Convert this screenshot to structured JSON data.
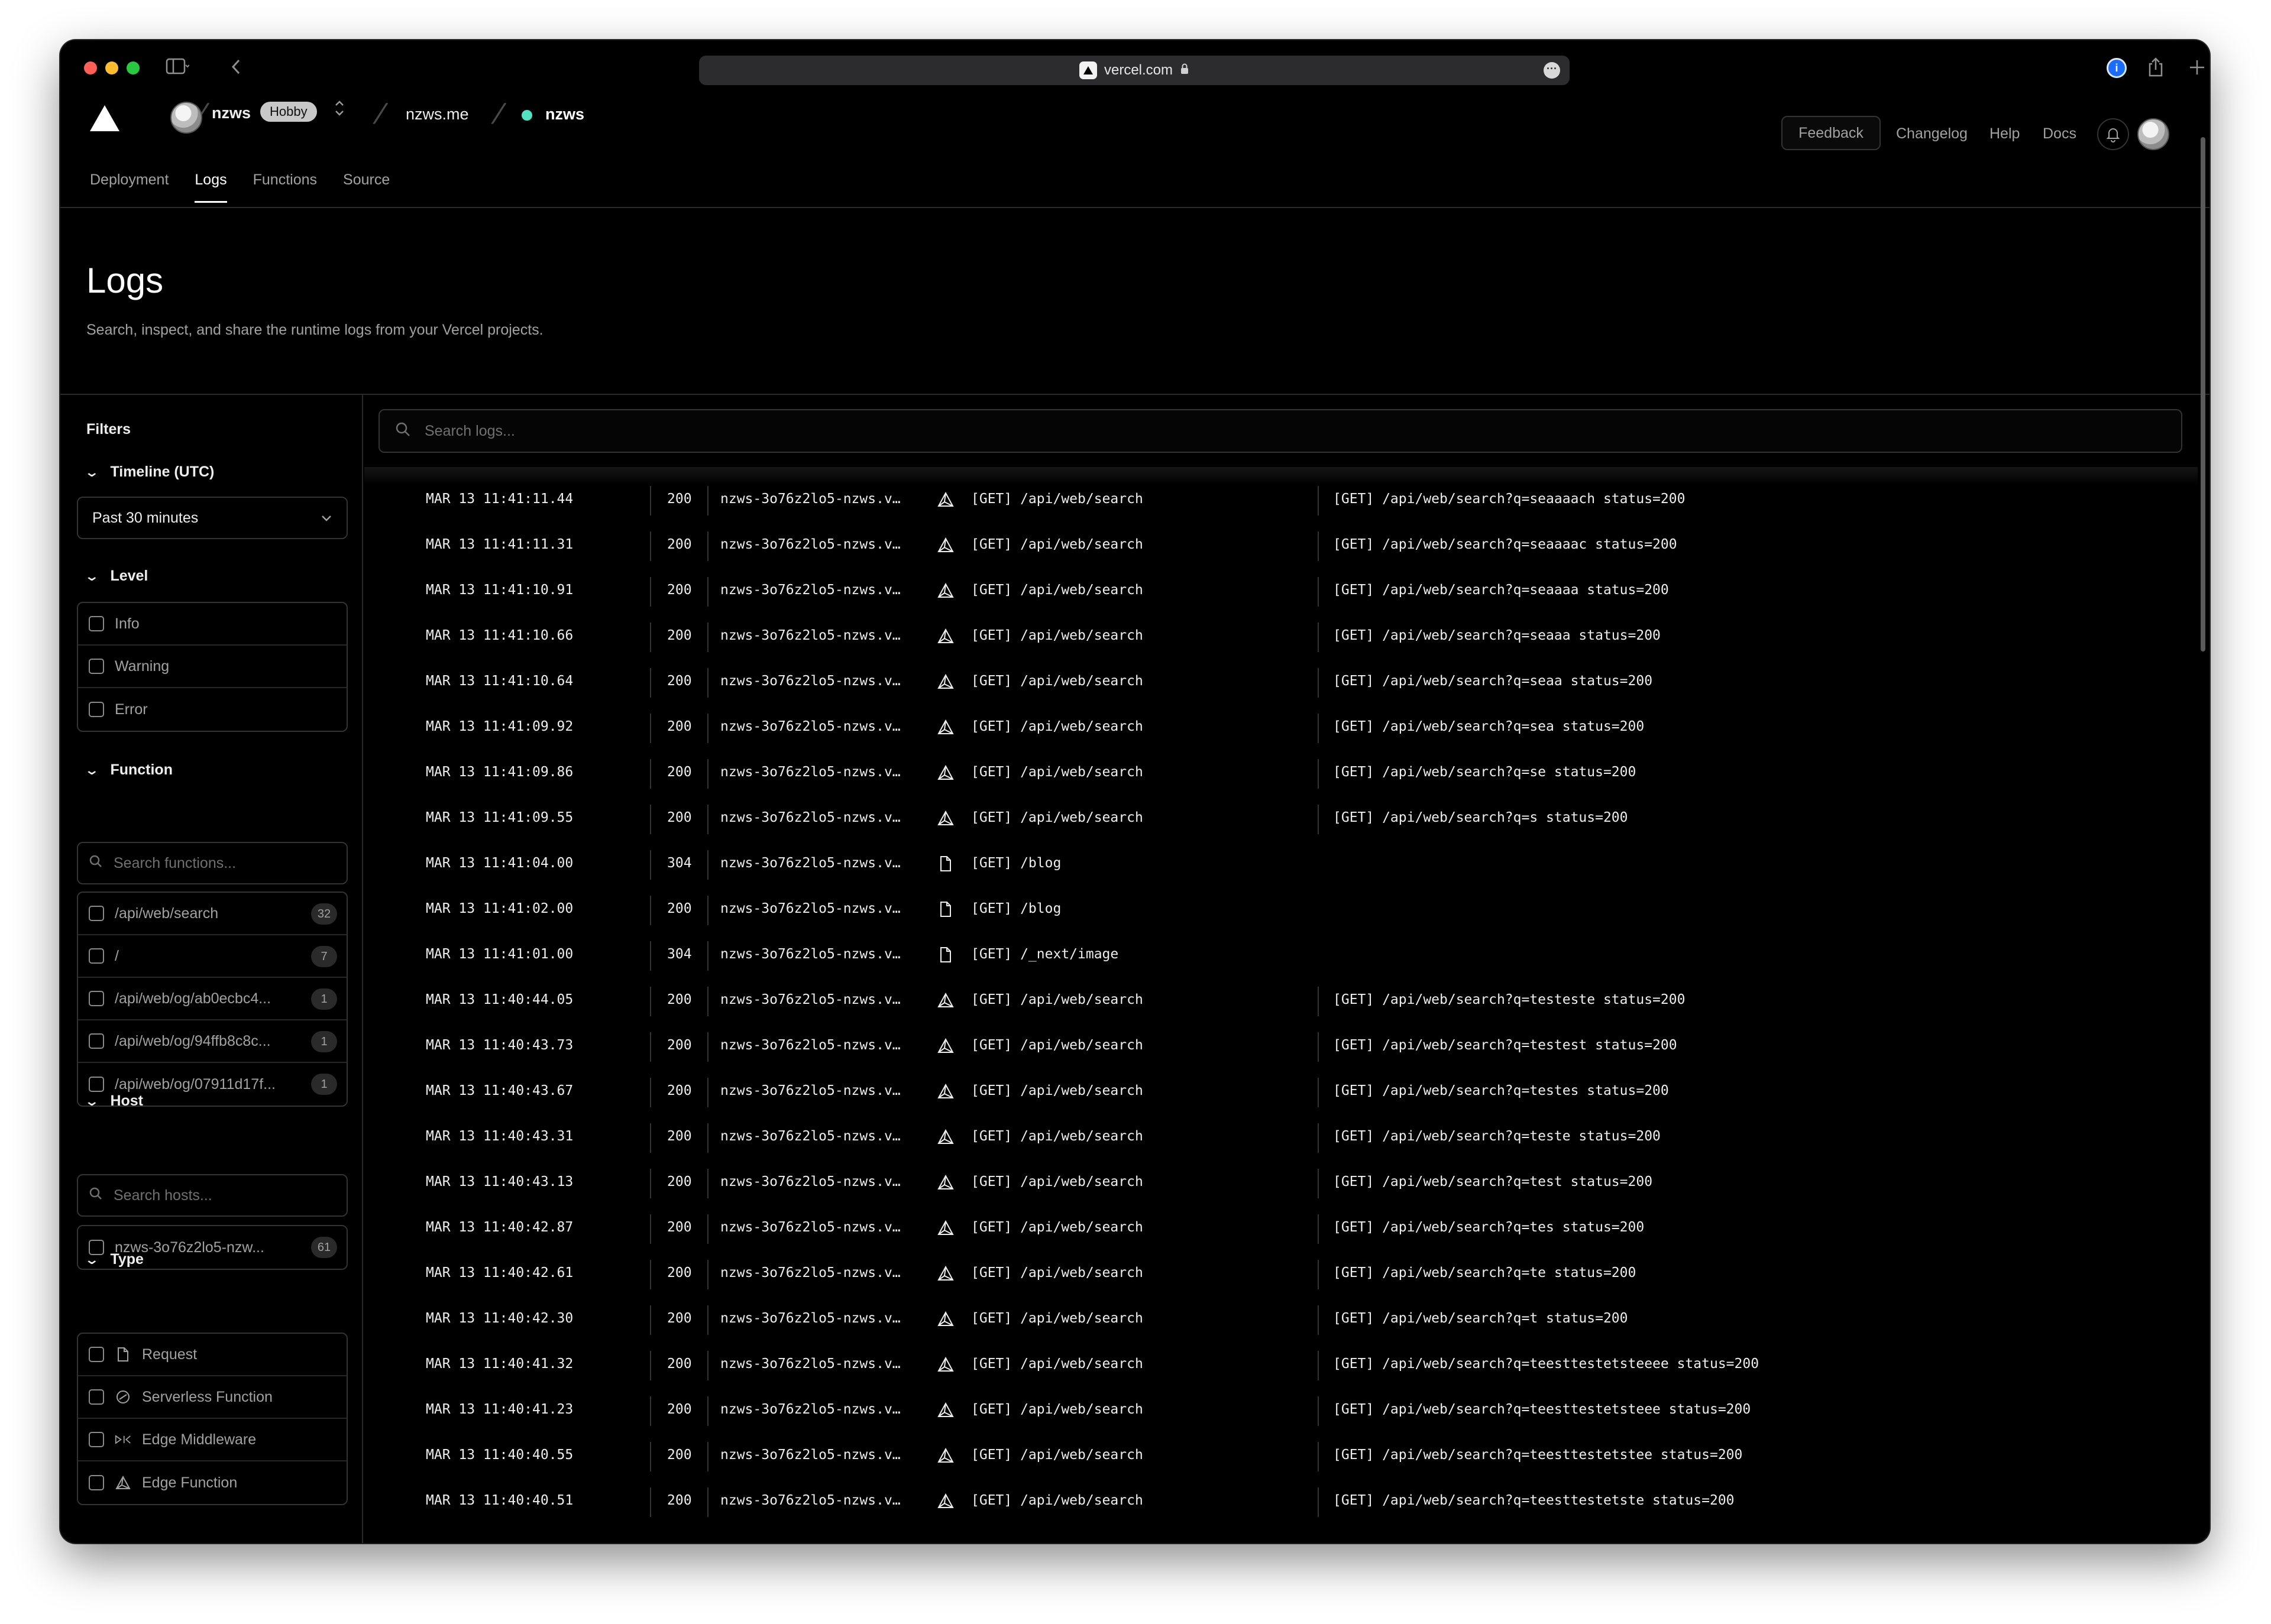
{
  "browser": {
    "url": "vercel.com",
    "colors": {
      "close": "#ff5f57",
      "minimize": "#febc2e",
      "zoom": "#28c840"
    }
  },
  "header": {
    "team": "nzws",
    "plan_badge": "Hobby",
    "project": "nzws.me",
    "deployment": "nzws",
    "deployment_status_color": "#50e3c2",
    "feedback_label": "Feedback",
    "links": [
      "Changelog",
      "Help",
      "Docs"
    ]
  },
  "tabs": [
    "Deployment",
    "Logs",
    "Functions",
    "Source"
  ],
  "active_tab": "Logs",
  "page": {
    "title": "Logs",
    "subtitle": "Search, inspect, and share the runtime logs from your Vercel projects."
  },
  "filters": {
    "title": "Filters",
    "timeline": {
      "label": "Timeline (UTC)",
      "selected": "Past 30 minutes"
    },
    "level": {
      "label": "Level",
      "options": [
        "Info",
        "Warning",
        "Error"
      ]
    },
    "function": {
      "label": "Function",
      "search_placeholder": "Search functions...",
      "items": [
        {
          "name": "/api/web/search",
          "count": "32"
        },
        {
          "name": "/",
          "count": "7"
        },
        {
          "name": "/api/web/og/ab0ecbc4...",
          "count": "1"
        },
        {
          "name": "/api/web/og/94ffb8c8c...",
          "count": "1"
        },
        {
          "name": "/api/web/og/07911d17f...",
          "count": "1"
        }
      ]
    },
    "host": {
      "label": "Host",
      "search_placeholder": "Search hosts...",
      "items": [
        {
          "name": "nzws-3o76z2lo5-nzw...",
          "count": "61"
        }
      ]
    },
    "type": {
      "label": "Type",
      "items": [
        {
          "name": "Request",
          "icon": "file-icon"
        },
        {
          "name": "Serverless Function",
          "icon": "lambda-icon"
        },
        {
          "name": "Edge Middleware",
          "icon": "middleware-icon"
        },
        {
          "name": "Edge Function",
          "icon": "edge-function-icon"
        }
      ]
    }
  },
  "logs": {
    "search_placeholder": "Search logs...",
    "rows": [
      {
        "time": "MAR 13 11:41:11.44",
        "status": "200",
        "host": "nzws-3o76z2lo5-nzws.v…",
        "icon": "edge-function-icon",
        "request": "[GET] /api/web/search",
        "message": "[GET] /api/web/search?q=seaaaach status=200"
      },
      {
        "time": "MAR 13 11:41:11.31",
        "status": "200",
        "host": "nzws-3o76z2lo5-nzws.v…",
        "icon": "edge-function-icon",
        "request": "[GET] /api/web/search",
        "message": "[GET] /api/web/search?q=seaaaac status=200"
      },
      {
        "time": "MAR 13 11:41:10.91",
        "status": "200",
        "host": "nzws-3o76z2lo5-nzws.v…",
        "icon": "edge-function-icon",
        "request": "[GET] /api/web/search",
        "message": "[GET] /api/web/search?q=seaaaa status=200"
      },
      {
        "time": "MAR 13 11:41:10.66",
        "status": "200",
        "host": "nzws-3o76z2lo5-nzws.v…",
        "icon": "edge-function-icon",
        "request": "[GET] /api/web/search",
        "message": "[GET] /api/web/search?q=seaaa status=200"
      },
      {
        "time": "MAR 13 11:41:10.64",
        "status": "200",
        "host": "nzws-3o76z2lo5-nzws.v…",
        "icon": "edge-function-icon",
        "request": "[GET] /api/web/search",
        "message": "[GET] /api/web/search?q=seaa status=200"
      },
      {
        "time": "MAR 13 11:41:09.92",
        "status": "200",
        "host": "nzws-3o76z2lo5-nzws.v…",
        "icon": "edge-function-icon",
        "request": "[GET] /api/web/search",
        "message": "[GET] /api/web/search?q=sea status=200"
      },
      {
        "time": "MAR 13 11:41:09.86",
        "status": "200",
        "host": "nzws-3o76z2lo5-nzws.v…",
        "icon": "edge-function-icon",
        "request": "[GET] /api/web/search",
        "message": "[GET] /api/web/search?q=se status=200"
      },
      {
        "time": "MAR 13 11:41:09.55",
        "status": "200",
        "host": "nzws-3o76z2lo5-nzws.v…",
        "icon": "edge-function-icon",
        "request": "[GET] /api/web/search",
        "message": "[GET] /api/web/search?q=s status=200"
      },
      {
        "time": "MAR 13 11:41:04.00",
        "status": "304",
        "host": "nzws-3o76z2lo5-nzws.v…",
        "icon": "file-icon",
        "request": "[GET] /blog",
        "message": ""
      },
      {
        "time": "MAR 13 11:41:02.00",
        "status": "200",
        "host": "nzws-3o76z2lo5-nzws.v…",
        "icon": "file-icon",
        "request": "[GET] /blog",
        "message": ""
      },
      {
        "time": "MAR 13 11:41:01.00",
        "status": "304",
        "host": "nzws-3o76z2lo5-nzws.v…",
        "icon": "file-icon",
        "request": "[GET] /_next/image",
        "message": ""
      },
      {
        "time": "MAR 13 11:40:44.05",
        "status": "200",
        "host": "nzws-3o76z2lo5-nzws.v…",
        "icon": "edge-function-icon",
        "request": "[GET] /api/web/search",
        "message": "[GET] /api/web/search?q=testeste status=200"
      },
      {
        "time": "MAR 13 11:40:43.73",
        "status": "200",
        "host": "nzws-3o76z2lo5-nzws.v…",
        "icon": "edge-function-icon",
        "request": "[GET] /api/web/search",
        "message": "[GET] /api/web/search?q=testest status=200"
      },
      {
        "time": "MAR 13 11:40:43.67",
        "status": "200",
        "host": "nzws-3o76z2lo5-nzws.v…",
        "icon": "edge-function-icon",
        "request": "[GET] /api/web/search",
        "message": "[GET] /api/web/search?q=testes status=200"
      },
      {
        "time": "MAR 13 11:40:43.31",
        "status": "200",
        "host": "nzws-3o76z2lo5-nzws.v…",
        "icon": "edge-function-icon",
        "request": "[GET] /api/web/search",
        "message": "[GET] /api/web/search?q=teste status=200"
      },
      {
        "time": "MAR 13 11:40:43.13",
        "status": "200",
        "host": "nzws-3o76z2lo5-nzws.v…",
        "icon": "edge-function-icon",
        "request": "[GET] /api/web/search",
        "message": "[GET] /api/web/search?q=test status=200"
      },
      {
        "time": "MAR 13 11:40:42.87",
        "status": "200",
        "host": "nzws-3o76z2lo5-nzws.v…",
        "icon": "edge-function-icon",
        "request": "[GET] /api/web/search",
        "message": "[GET] /api/web/search?q=tes status=200"
      },
      {
        "time": "MAR 13 11:40:42.61",
        "status": "200",
        "host": "nzws-3o76z2lo5-nzws.v…",
        "icon": "edge-function-icon",
        "request": "[GET] /api/web/search",
        "message": "[GET] /api/web/search?q=te status=200"
      },
      {
        "time": "MAR 13 11:40:42.30",
        "status": "200",
        "host": "nzws-3o76z2lo5-nzws.v…",
        "icon": "edge-function-icon",
        "request": "[GET] /api/web/search",
        "message": "[GET] /api/web/search?q=t status=200"
      },
      {
        "time": "MAR 13 11:40:41.32",
        "status": "200",
        "host": "nzws-3o76z2lo5-nzws.v…",
        "icon": "edge-function-icon",
        "request": "[GET] /api/web/search",
        "message": "[GET] /api/web/search?q=teesttestetsteeee status=200"
      },
      {
        "time": "MAR 13 11:40:41.23",
        "status": "200",
        "host": "nzws-3o76z2lo5-nzws.v…",
        "icon": "edge-function-icon",
        "request": "[GET] /api/web/search",
        "message": "[GET] /api/web/search?q=teesttestetsteee status=200"
      },
      {
        "time": "MAR 13 11:40:40.55",
        "status": "200",
        "host": "nzws-3o76z2lo5-nzws.v…",
        "icon": "edge-function-icon",
        "request": "[GET] /api/web/search",
        "message": "[GET] /api/web/search?q=teesttestetstee status=200"
      },
      {
        "time": "MAR 13 11:40:40.51",
        "status": "200",
        "host": "nzws-3o76z2lo5-nzws.v…",
        "icon": "edge-function-icon",
        "request": "[GET] /api/web/search",
        "message": "[GET] /api/web/search?q=teesttestetste status=200"
      }
    ]
  }
}
